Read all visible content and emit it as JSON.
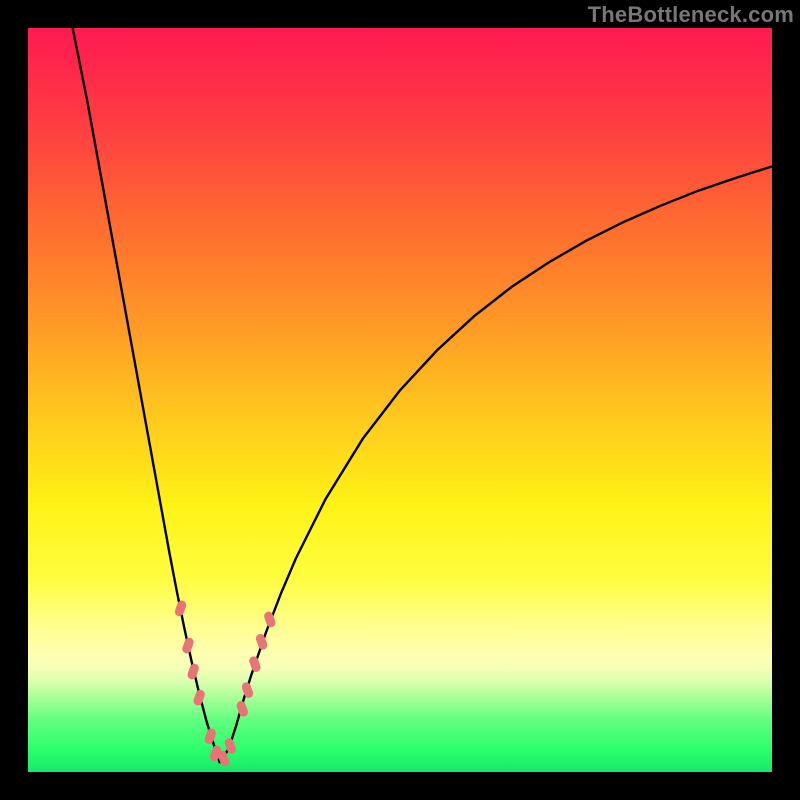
{
  "watermark": "TheBottleneck.com",
  "colors": {
    "frame": "#000000",
    "curve": "#000000",
    "marker": "#e77575"
  },
  "chart_data": {
    "type": "line",
    "title": "",
    "xlabel": "",
    "ylabel": "",
    "xlim": [
      0,
      100
    ],
    "ylim": [
      0,
      100
    ],
    "x_at_minimum": 25,
    "series": [
      {
        "name": "left-branch",
        "x": [
          6,
          8,
          10,
          12,
          14,
          16,
          18,
          19,
          20,
          21,
          22,
          23,
          24,
          25,
          25.8
        ],
        "y": [
          100,
          90,
          79,
          68,
          57,
          46,
          35,
          29.5,
          24.3,
          19.4,
          14.8,
          10.6,
          6.8,
          3.6,
          1.2
        ]
      },
      {
        "name": "right-branch",
        "x": [
          25.8,
          27,
          28,
          29,
          30,
          32,
          34,
          36,
          40,
          45,
          50,
          55,
          60,
          65,
          70,
          75,
          80,
          85,
          90,
          95,
          100
        ],
        "y": [
          1.2,
          3.2,
          6.3,
          9.8,
          13.0,
          18.8,
          24.0,
          28.7,
          36.7,
          44.8,
          51.3,
          56.7,
          61.3,
          65.2,
          68.5,
          71.4,
          73.9,
          76.1,
          78.1,
          79.8,
          81.4
        ]
      }
    ],
    "markers": [
      {
        "series": "left-branch",
        "x": 20.5,
        "y": 22.0
      },
      {
        "series": "left-branch",
        "x": 21.5,
        "y": 17.0
      },
      {
        "series": "left-branch",
        "x": 22.2,
        "y": 13.5
      },
      {
        "series": "left-branch",
        "x": 23.0,
        "y": 10.0
      },
      {
        "series": "left-branch",
        "x": 24.5,
        "y": 4.8
      },
      {
        "series": "left-branch",
        "x": 25.2,
        "y": 2.5
      },
      {
        "series": "right-branch",
        "x": 26.3,
        "y": 1.8
      },
      {
        "series": "right-branch",
        "x": 27.2,
        "y": 3.5
      },
      {
        "series": "right-branch",
        "x": 28.8,
        "y": 8.5
      },
      {
        "series": "right-branch",
        "x": 29.5,
        "y": 11.0
      },
      {
        "series": "right-branch",
        "x": 30.5,
        "y": 14.5
      },
      {
        "series": "right-branch",
        "x": 31.4,
        "y": 17.5
      },
      {
        "series": "right-branch",
        "x": 32.5,
        "y": 20.5
      }
    ],
    "background_gradient_stops": [
      {
        "pos": 0,
        "color": "#ff1a51"
      },
      {
        "pos": 14,
        "color": "#ff4040"
      },
      {
        "pos": 40,
        "color": "#ff9a26"
      },
      {
        "pos": 64,
        "color": "#fff215"
      },
      {
        "pos": 88,
        "color": "#d7ffac"
      },
      {
        "pos": 100,
        "color": "#18e86a"
      }
    ]
  }
}
